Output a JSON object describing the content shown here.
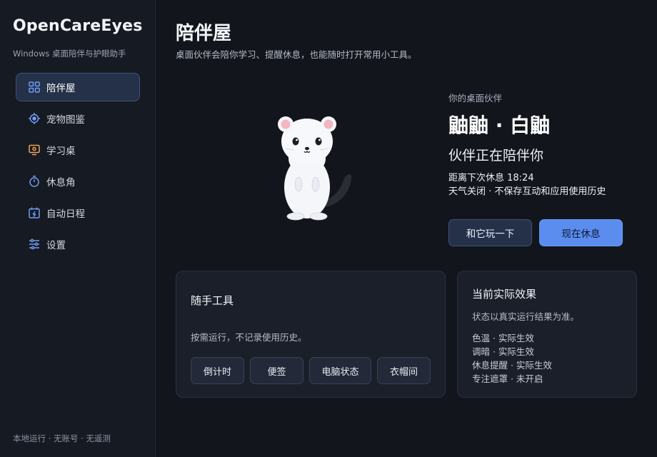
{
  "sidebar": {
    "brand": "OpenCareEyes",
    "subtitle": "Windows 桌面陪伴与护眼助手",
    "items": [
      {
        "label": "陪伴屋",
        "icon": "grid-icon",
        "active": true
      },
      {
        "label": "宠物图鉴",
        "icon": "target-icon",
        "active": false
      },
      {
        "label": "学习桌",
        "icon": "monitor-icon",
        "active": false
      },
      {
        "label": "休息角",
        "icon": "timer-icon",
        "active": false
      },
      {
        "label": "自动日程",
        "icon": "calendar-icon",
        "active": false
      },
      {
        "label": "设置",
        "icon": "sliders-icon",
        "active": false
      }
    ],
    "footer": "本地运行 · 无账号 · 无遥测"
  },
  "main": {
    "title": "陪伴屋",
    "subtitle": "桌面伙伴会陪你学习、提醒休息，也能随时打开常用小工具。",
    "companion": {
      "label": "你的桌面伙伴",
      "name": "鼬鼬 · 白鼬",
      "status": "伙伴正在陪伴你",
      "next_break": "距离下次休息 18:24",
      "privacy": "天气关闭 · 不保存互动和应用使用历史",
      "play_button": "和它玩一下",
      "rest_button": "现在休息"
    },
    "tools": {
      "title": "随手工具",
      "desc": "按需运行，不记录使用历史。",
      "buttons": [
        "倒计时",
        "便签",
        "电脑状态",
        "衣帽间"
      ]
    },
    "effects": {
      "title": "当前实际效果",
      "desc": "状态以真实运行结果为准。",
      "items": [
        "色温 · 实际生效",
        "调暗 · 实际生效",
        "休息提醒 · 实际生效",
        "专注遮罩 · 未开启"
      ]
    }
  },
  "colors": {
    "accent": "#5b8def",
    "background": "#12151c",
    "sidebar": "#161a22",
    "active_item": "#243149"
  }
}
